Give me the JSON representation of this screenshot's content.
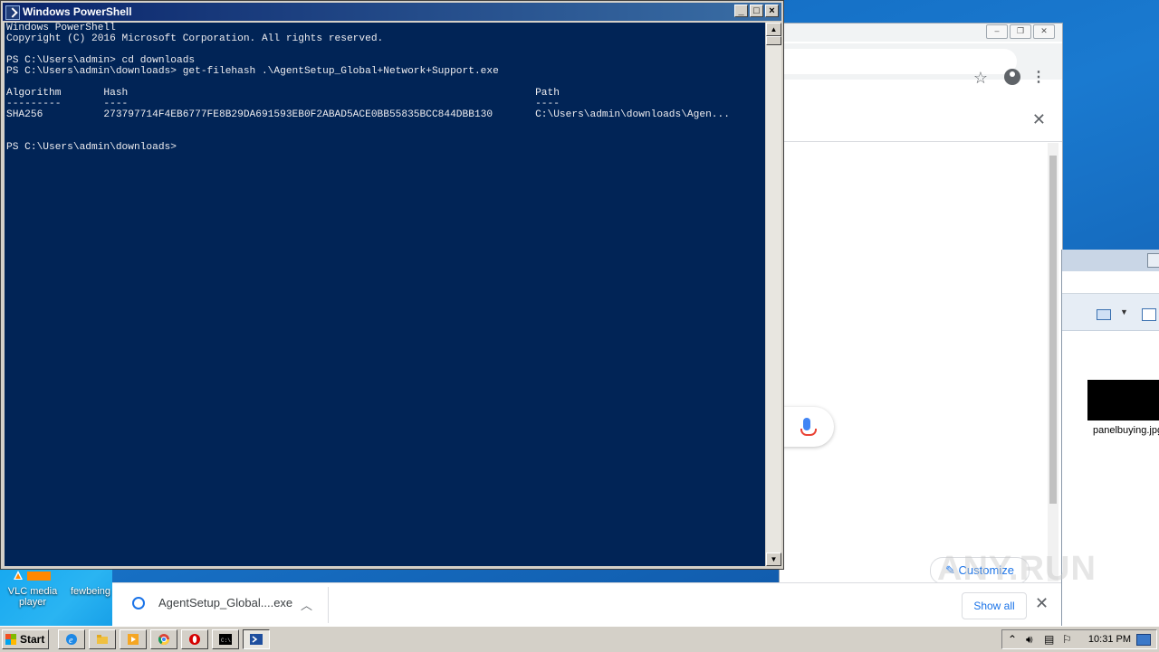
{
  "powershell": {
    "title": "Windows PowerShell",
    "lines": [
      "Windows PowerShell",
      "Copyright (C) 2016 Microsoft Corporation. All rights reserved.",
      "",
      "PS C:\\Users\\admin> cd downloads",
      "PS C:\\Users\\admin\\downloads> get-filehash .\\AgentSetup_Global+Network+Support.exe",
      "",
      "Algorithm       Hash                                                                   Path",
      "---------       ----                                                                   ----",
      "SHA256          273797714F4EB6777FE8B29DA691593EB0F2ABAD5ACE0BB55835BCC844DBB130       C:\\Users\\admin\\downloads\\Agen...",
      "",
      "",
      "PS C:\\Users\\admin\\downloads>"
    ],
    "controls": {
      "minimize": "_",
      "maximize": "□",
      "close": "×"
    }
  },
  "chrome": {
    "customize_label": "Customize",
    "download": {
      "filename": "AgentSetup_Global....exe",
      "show_all": "Show all"
    }
  },
  "explorer": {
    "file_label": "panelbuying.jpg"
  },
  "desktop": {
    "icons": [
      {
        "label": "VLC media\nplayer"
      },
      {
        "label": "fewbeing"
      }
    ]
  },
  "watermark": "ANY.RUN",
  "taskbar": {
    "start_label": "Start",
    "clock": "10:31 PM"
  },
  "colors": {
    "console_bg": "#012456",
    "console_fg": "#eeedf0",
    "accent": "#1a73e8"
  }
}
